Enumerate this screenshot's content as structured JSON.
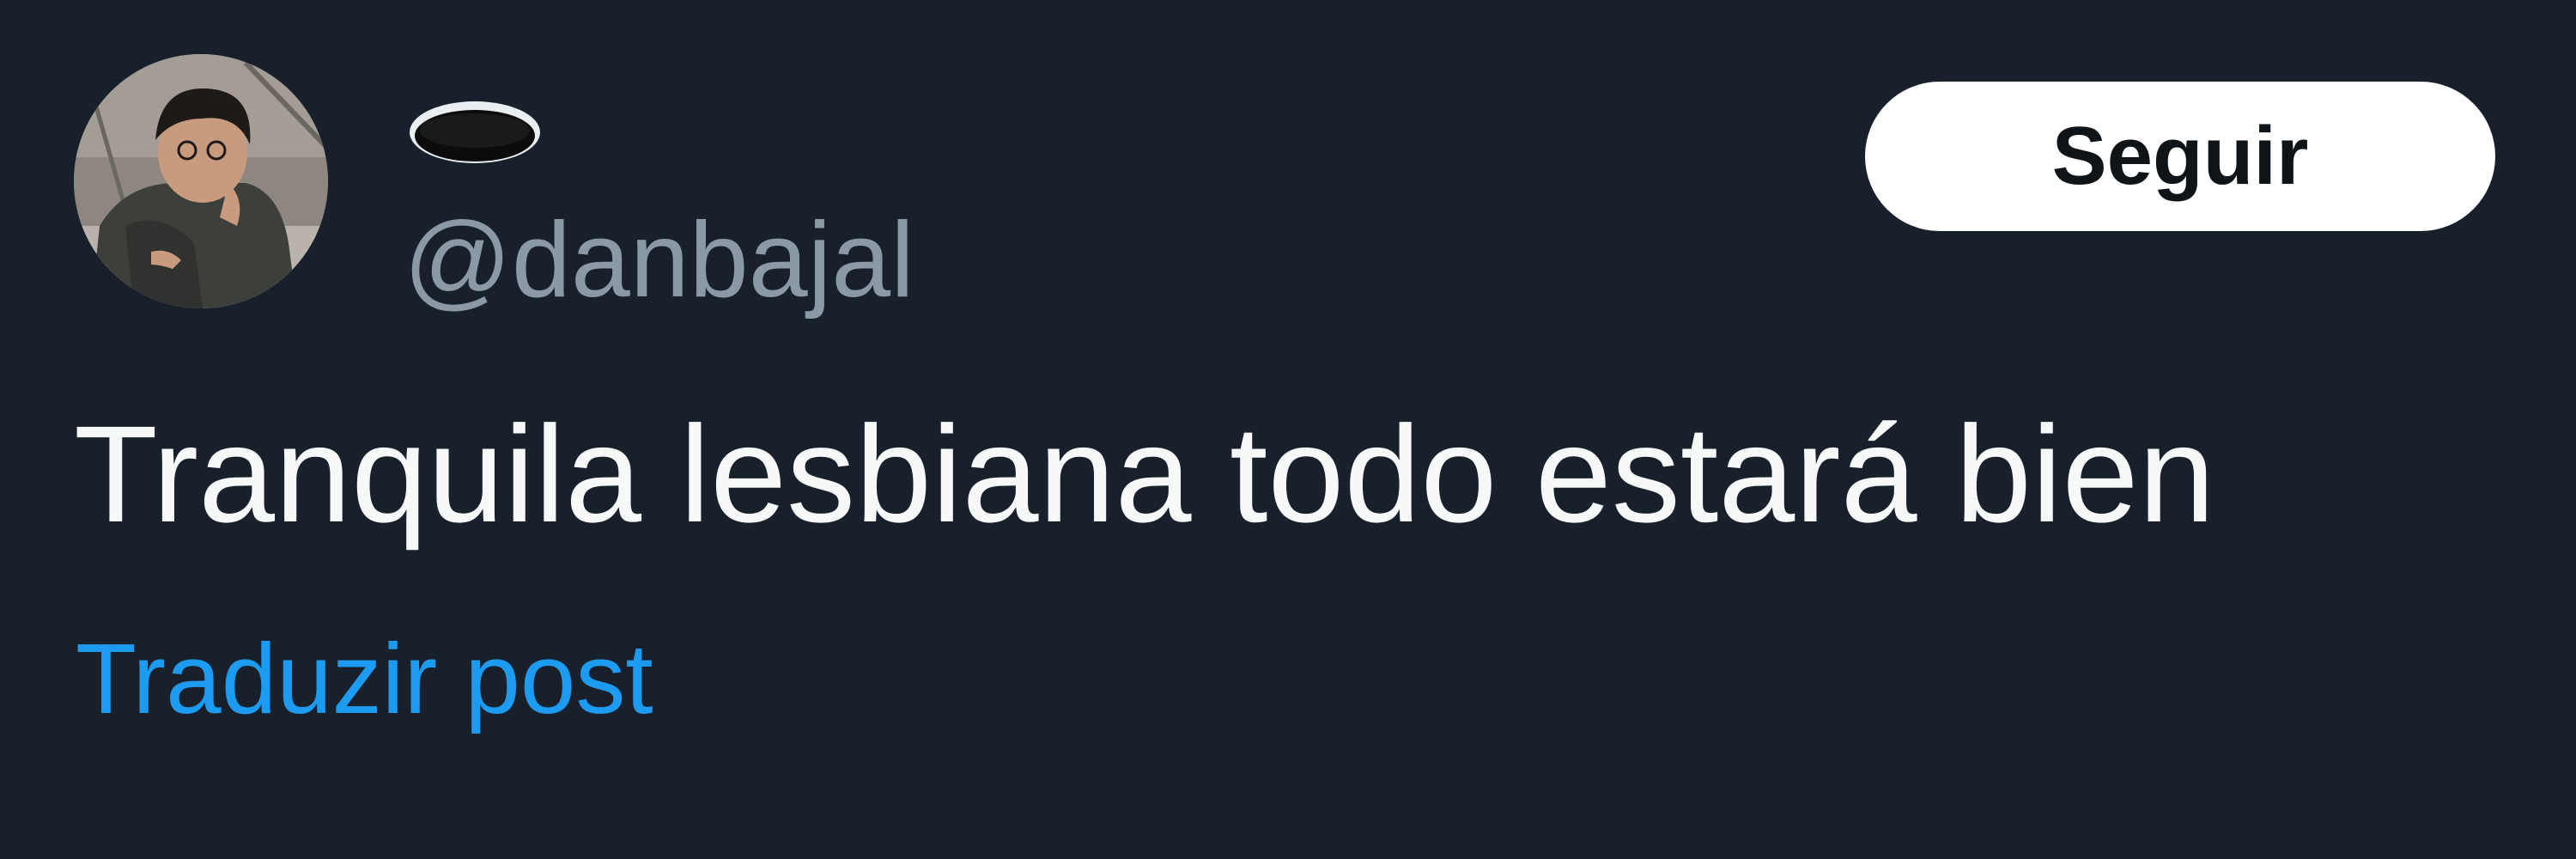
{
  "post": {
    "author": {
      "display_name_icon": "hole-emoji",
      "handle": "@danbajal"
    },
    "follow_label": "Seguir",
    "text": "Tranquila lesbiana todo estará bien",
    "translate_label": "Traduzir post"
  },
  "colors": {
    "background": "#17202b",
    "text": "#f7f9f9",
    "handle": "#8b98a5",
    "link": "#1d9bf0",
    "button_bg": "#ffffff",
    "button_text": "#0f1419"
  }
}
